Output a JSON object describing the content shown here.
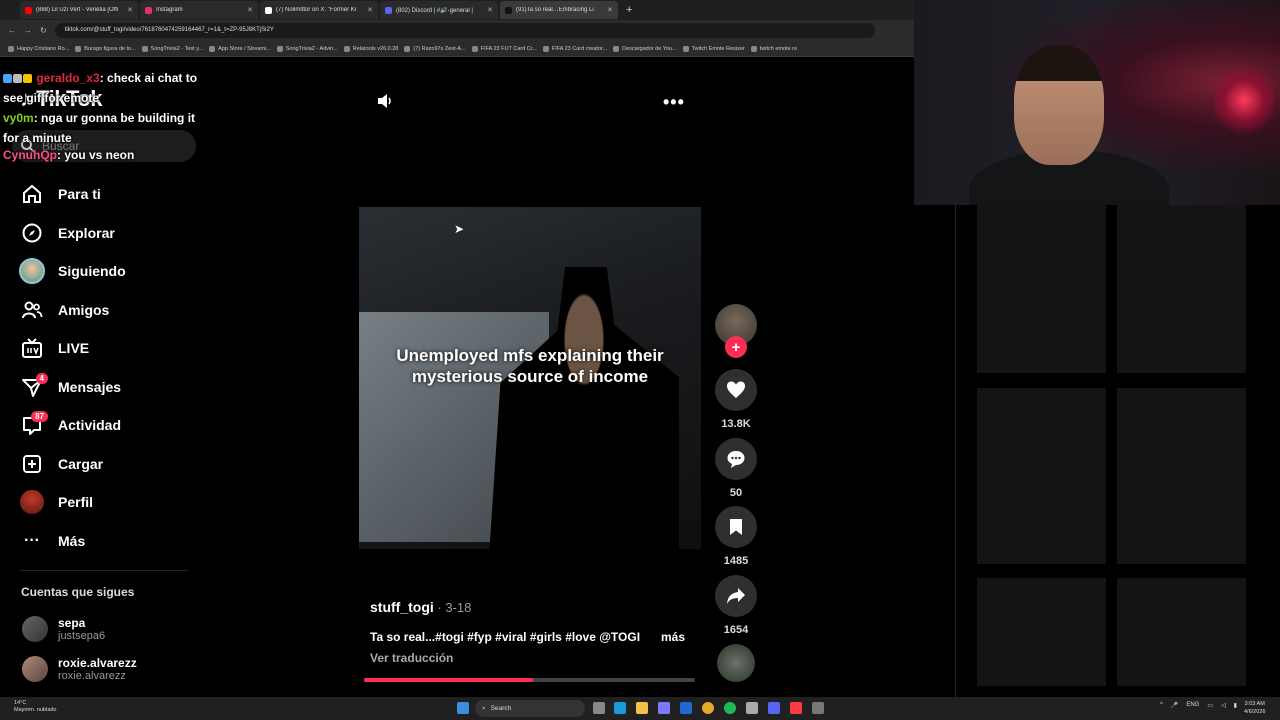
{
  "browser": {
    "tabs": [
      {
        "label": "(888) Lil Uzi Vert - Venetia [Offi",
        "color": "#ff0000"
      },
      {
        "label": "Instagram",
        "color": "#e1306c"
      },
      {
        "label": "(7) Nolimittor on X: \"Former Ki",
        "color": "#ffffff"
      },
      {
        "label": "(802) Discord | #🔊-general | ",
        "color": "#5865f2"
      },
      {
        "label": "(91)Ta so real…Embracing Li",
        "color": "#111111"
      }
    ],
    "new_tab": "+",
    "url": "tiktok.com/@stuff_togi/video/7618760474259164467_r=1&_t=ZP-95J8KTjSi2Y",
    "bookmarks": [
      "Happy Cristiano Ro...",
      "Burago figura de to...",
      "SongTrivia2 - Test y...",
      "App Store / Streami...",
      "SongTrivia2 - Advin...",
      "Relatools v26.0.28",
      "(7) Razo97s Zest-A...",
      "FIFA 23 FUT Card Cr...",
      "FIFA 23 Card creator...",
      "Descargador de You...",
      "Twitch Emote Resizer",
      "twitch emote re"
    ]
  },
  "chat": [
    {
      "user": "geraldo_x3",
      "msg": ": check ai chat to see gif for emote"
    },
    {
      "user": "vy0m",
      "msg": ": nga ur gonna be building it for a minute"
    },
    {
      "user": "CynuhQp",
      "msg": ": you vs neon"
    }
  ],
  "sidebar": {
    "logo": "TikTok",
    "search_placeholder": "Buscar",
    "items": [
      {
        "label": "Para ti",
        "badge": ""
      },
      {
        "label": "Explorar",
        "badge": ""
      },
      {
        "label": "Siguiendo",
        "badge": ""
      },
      {
        "label": "Amigos",
        "badge": ""
      },
      {
        "label": "LIVE",
        "badge": ""
      },
      {
        "label": "Mensajes",
        "badge": "4"
      },
      {
        "label": "Actividad",
        "badge": "87"
      },
      {
        "label": "Cargar",
        "badge": ""
      },
      {
        "label": "Perfil",
        "badge": ""
      },
      {
        "label": "Más",
        "badge": ""
      }
    ],
    "following_header": "Cuentas que sigues",
    "following": [
      {
        "name": "sepa",
        "handle": "justsepa6"
      },
      {
        "name": "roxie.alvarezz",
        "handle": "roxie.alvarezz"
      }
    ]
  },
  "video": {
    "caption": "Unemployed mfs explaining their mysterious source of income",
    "author": "stuff_togi",
    "date": " · 3-18",
    "description": "Ta so real...#togi #fyp #viral #girls #love @TOGI",
    "more": "más",
    "translate": "Ver traducción",
    "progress": 0.51,
    "likes": "13.8K",
    "comments": "50",
    "saves": "1485",
    "shares": "1654"
  },
  "taskbar": {
    "weather_temp": "14°C",
    "weather_desc": "Mayorm. nublado",
    "search": "Search",
    "lang": "ENG",
    "time": "3:03 AM",
    "date": "4/6/2026"
  },
  "colors": {
    "accent": "#fe2c55",
    "background": "#000000"
  }
}
